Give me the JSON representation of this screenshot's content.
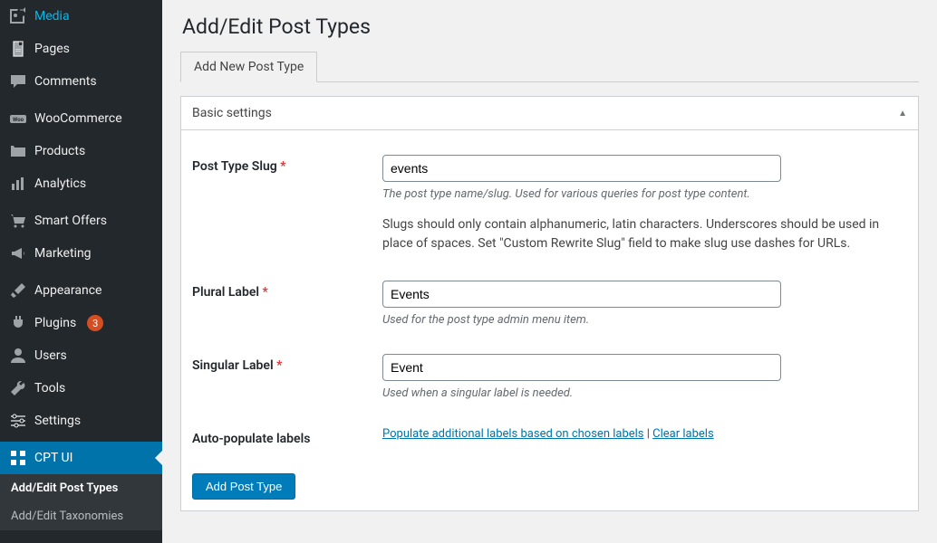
{
  "sidebar": {
    "items": [
      {
        "label": "Media",
        "icon": "media"
      },
      {
        "label": "Pages",
        "icon": "pages"
      },
      {
        "label": "Comments",
        "icon": "comments"
      },
      {
        "sep": true
      },
      {
        "label": "WooCommerce",
        "icon": "woo"
      },
      {
        "label": "Products",
        "icon": "products"
      },
      {
        "label": "Analytics",
        "icon": "analytics"
      },
      {
        "sep": true
      },
      {
        "label": "Smart Offers",
        "icon": "cart"
      },
      {
        "label": "Marketing",
        "icon": "megaphone"
      },
      {
        "sep": true
      },
      {
        "label": "Appearance",
        "icon": "brush"
      },
      {
        "label": "Plugins",
        "icon": "plugin",
        "badge": "3"
      },
      {
        "label": "Users",
        "icon": "user"
      },
      {
        "label": "Tools",
        "icon": "tools"
      },
      {
        "label": "Settings",
        "icon": "settings"
      },
      {
        "sep": true
      },
      {
        "label": "CPT UI",
        "icon": "cpt",
        "active": true
      }
    ],
    "submenu": [
      {
        "label": "Add/Edit Post Types",
        "current": true
      },
      {
        "label": "Add/Edit Taxonomies"
      }
    ]
  },
  "page": {
    "title": "Add/Edit Post Types",
    "tab_label": "Add New Post Type"
  },
  "panel": {
    "title": "Basic settings"
  },
  "fields": {
    "slug": {
      "label": "Post Type Slug",
      "value": "events",
      "desc": "The post type name/slug. Used for various queries for post type content.",
      "help": "Slugs should only contain alphanumeric, latin characters. Underscores should be used in place of spaces. Set \"Custom Rewrite Slug\" field to make slug use dashes for URLs."
    },
    "plural": {
      "label": "Plural Label",
      "value": "Events",
      "desc": "Used for the post type admin menu item."
    },
    "singular": {
      "label": "Singular Label",
      "value": "Event",
      "desc": "Used when a singular label is needed."
    },
    "autopop": {
      "label": "Auto-populate labels",
      "link1": "Populate additional labels based on chosen labels",
      "sep": " | ",
      "link2": "Clear labels"
    }
  },
  "actions": {
    "submit": "Add Post Type"
  }
}
